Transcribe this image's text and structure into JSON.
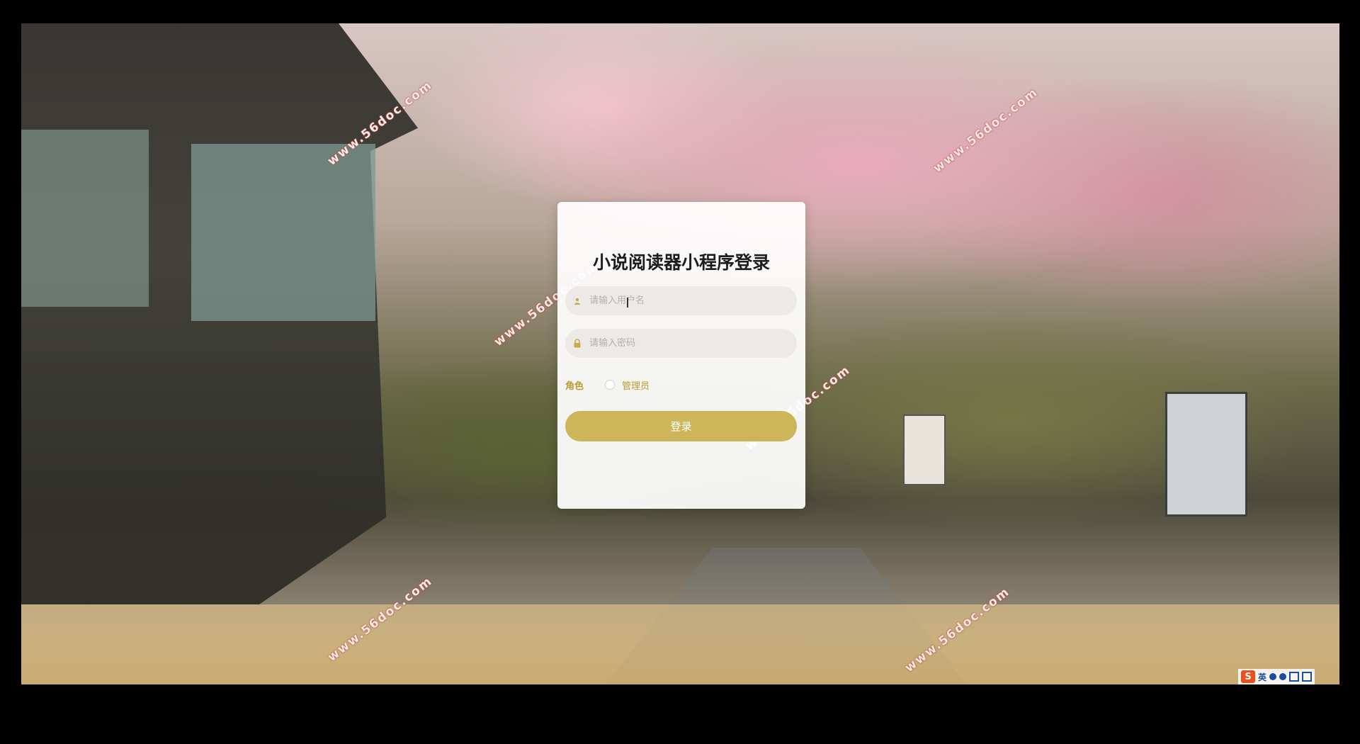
{
  "login": {
    "title": "小说阅读器小程序登录",
    "username_placeholder": "请输入用户名",
    "password_placeholder": "请输入密码",
    "role_label": "角色",
    "role_option": "管理员",
    "submit_label": "登录"
  },
  "watermark": {
    "text": "www.56doc.com"
  },
  "ime": {
    "logo": "S",
    "lang": "英"
  },
  "colors": {
    "accent": "#cdb55a",
    "label": "#b89a2e",
    "watermark_outline": "#c0392b"
  },
  "icons": {
    "username": "user-icon",
    "password": "lock-icon"
  }
}
